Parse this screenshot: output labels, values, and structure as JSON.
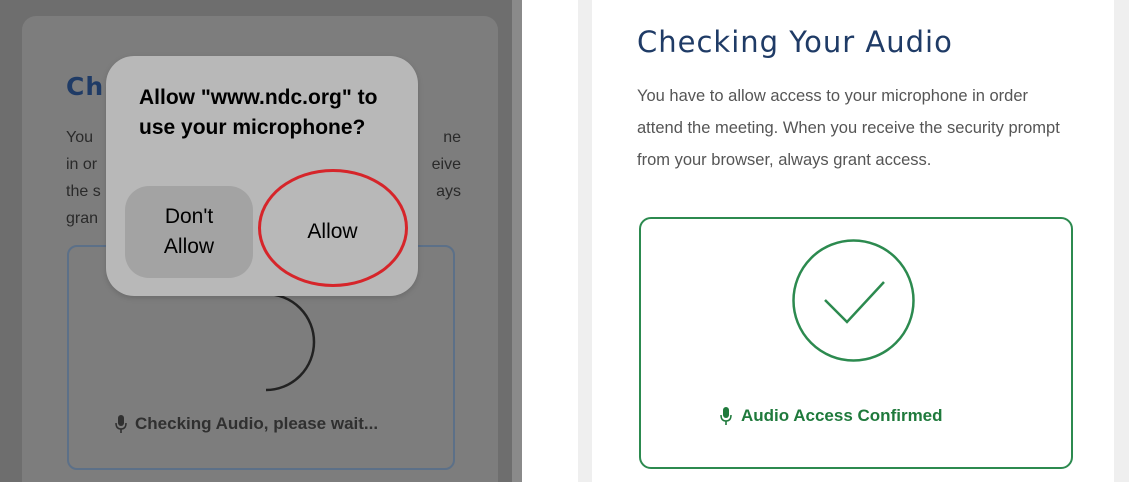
{
  "left": {
    "title": "Ch",
    "para_fragments": [
      "You ",
      "in or",
      "the s",
      "gran"
    ],
    "para_right_fragments": [
      "ne",
      "eive",
      "ays"
    ],
    "status": "Checking Audio, please wait..."
  },
  "dialog": {
    "title": "Allow \"www.ndc.org\" to use your microphone?",
    "deny_label_line1": "Don't",
    "deny_label_line2": "Allow",
    "allow_label": "Allow"
  },
  "right": {
    "title": "Checking Your Audio",
    "para": "You have to allow access to your microphone in order attend the meeting. When you receive the security prompt from your browser, always grant access.",
    "status": "Audio Access Confirmed"
  },
  "colors": {
    "heading": "#1f3b66",
    "success": "#1f7a3c",
    "highlight": "#d6252a"
  },
  "icons": [
    "microphone-icon",
    "checkmark-icon",
    "spinner-icon"
  ]
}
